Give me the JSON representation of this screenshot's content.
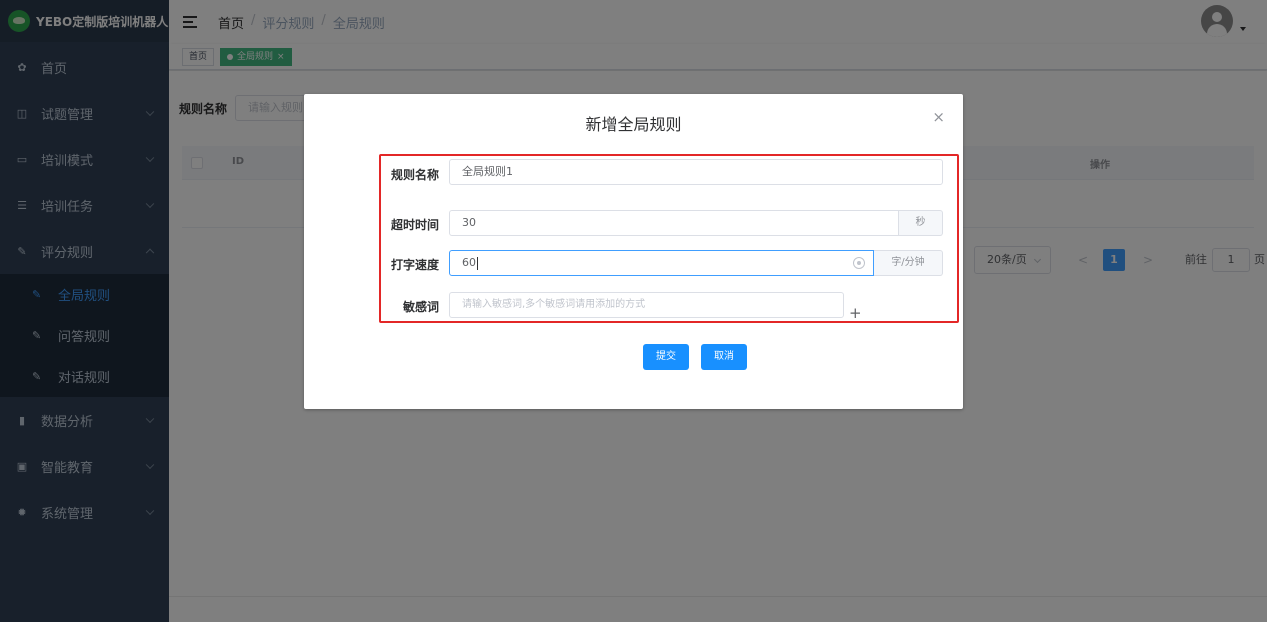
{
  "brand": {
    "title": "YEBO定制版培训机器人"
  },
  "sidebar": {
    "items": [
      {
        "label": "首页",
        "icon": "dashboard-icon"
      },
      {
        "label": "试题管理",
        "icon": "book-icon"
      },
      {
        "label": "培训模式",
        "icon": "monitor-icon"
      },
      {
        "label": "培训任务",
        "icon": "list-icon"
      },
      {
        "label": "评分规则",
        "icon": "edit-icon"
      },
      {
        "label": "数据分析",
        "icon": "bar-chart-icon"
      },
      {
        "label": "智能教育",
        "icon": "screen-icon"
      },
      {
        "label": "系统管理",
        "icon": "gear-icon"
      }
    ],
    "sub_items": [
      {
        "label": "全局规则",
        "active": true
      },
      {
        "label": "问答规则",
        "active": false
      },
      {
        "label": "对话规则",
        "active": false
      }
    ]
  },
  "breadcrumb": [
    "首页",
    "评分规则",
    "全局规则"
  ],
  "tags": [
    {
      "label": "首页",
      "active": false
    },
    {
      "label": "全局规则",
      "active": true,
      "close": "×"
    }
  ],
  "page": {
    "filter_label": "规则名称",
    "filter_placeholder": "请输入规则",
    "table_headers": [
      "ID",
      "操作"
    ],
    "pagination": {
      "page_size": "20条/页",
      "current_page": "1",
      "goto_label": "前往",
      "goto_value": "1",
      "page_suffix": "页",
      "prev": "<",
      "next": ">"
    }
  },
  "dialog": {
    "title": "新增全局规则",
    "close": "×",
    "fields": {
      "rule_name": {
        "label": "规则名称",
        "value": "全局规则1"
      },
      "timeout": {
        "label": "超时时间",
        "value": "30",
        "unit": "秒"
      },
      "typing_speed": {
        "label": "打字速度",
        "value": "60",
        "unit": "字/分钟"
      },
      "sensitive_words": {
        "label": "敏感词",
        "placeholder": "请输入敏感词,多个敏感词请用添加的方式",
        "add": "+"
      }
    },
    "submit_label": "提交",
    "cancel_label": "取消"
  },
  "colors": {
    "sidebar_bg": "#304156",
    "submenu_bg": "#1f2d3d",
    "active_text": "#409eff",
    "tag_active": "#42b983",
    "primary_button": "#1890ff",
    "highlight_border": "#e32727"
  }
}
